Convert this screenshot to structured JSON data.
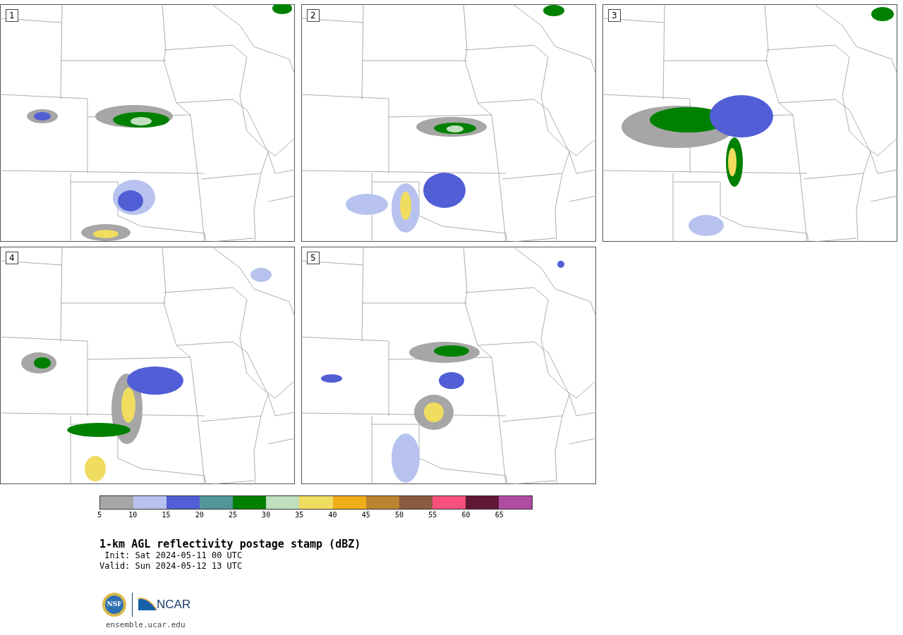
{
  "panels": [
    {
      "label": "1"
    },
    {
      "label": "2"
    },
    {
      "label": "3"
    },
    {
      "label": "4"
    },
    {
      "label": "5"
    }
  ],
  "colorbar": {
    "bins": [
      {
        "color": "#a6a6a6"
      },
      {
        "color": "#b7c3ee"
      },
      {
        "color": "#515ed6"
      },
      {
        "color": "#50969b"
      },
      {
        "color": "#008000"
      },
      {
        "color": "#bfdfbe"
      },
      {
        "color": "#f0dc5f"
      },
      {
        "color": "#f0ae18"
      },
      {
        "color": "#bb8431"
      },
      {
        "color": "#8c5a3e"
      },
      {
        "color": "#f7507c"
      },
      {
        "color": "#5f1735"
      },
      {
        "color": "#ae4ca4"
      }
    ],
    "ticks": [
      "5",
      "10",
      "15",
      "20",
      "25",
      "30",
      "35",
      "40",
      "45",
      "50",
      "55",
      "60",
      "65"
    ]
  },
  "title": "1-km AGL reflectivity postage stamp (dBZ)",
  "init": " Init: Sat 2024-05-11 00 UTC",
  "valid": "Valid: Sun 2024-05-12 13 UTC",
  "logo": {
    "nsf_text": "NSF",
    "ncar_text": "NCAR"
  },
  "url": "ensemble.ucar.edu"
}
